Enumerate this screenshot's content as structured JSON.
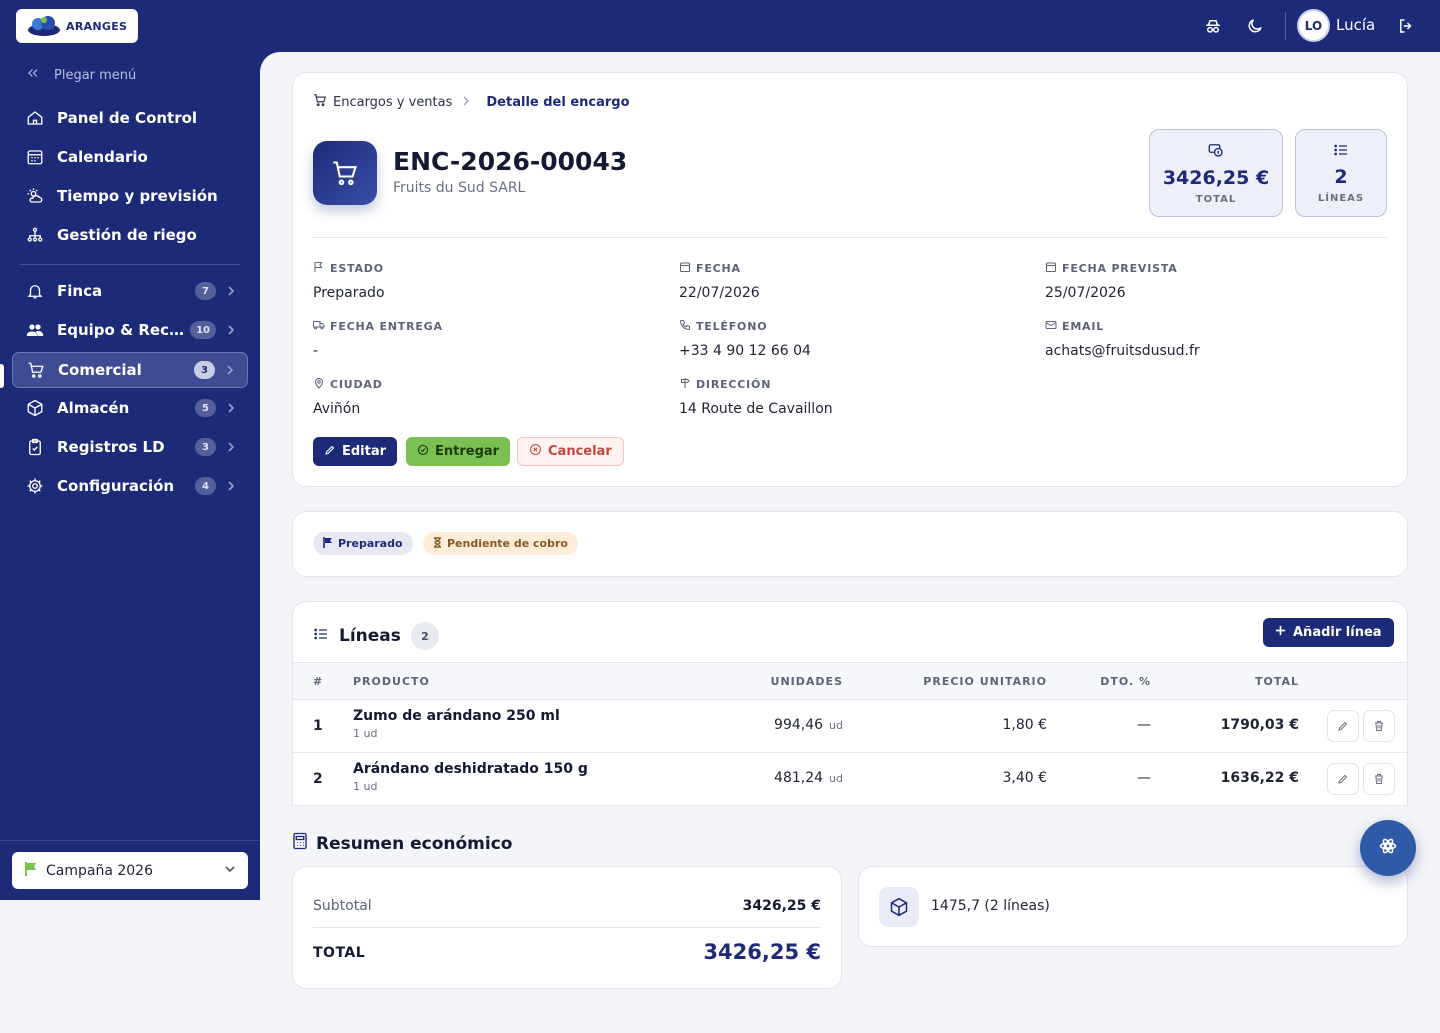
{
  "app": {
    "logo_text": "ARANGES"
  },
  "user": {
    "initials": "LO",
    "name": "Lucía"
  },
  "sidebar": {
    "collapse_label": "Plegar menú",
    "items": [
      {
        "label": "Panel de Control",
        "icon": "home-icon"
      },
      {
        "label": "Calendario",
        "icon": "calendar-icon"
      },
      {
        "label": "Tiempo y previsión",
        "icon": "weather-icon"
      },
      {
        "label": "Gestión de riego",
        "icon": "irrigation-icon"
      },
      {
        "label": "Finca",
        "icon": "sprout-icon",
        "badge": "7"
      },
      {
        "label": "Equipo & Recursos",
        "icon": "team-icon",
        "badge": "10"
      },
      {
        "label": "Comercial",
        "icon": "cart-icon",
        "badge": "3",
        "active": true
      },
      {
        "label": "Almacén",
        "icon": "box-icon",
        "badge": "5"
      },
      {
        "label": "Registros LD",
        "icon": "clipboard-icon",
        "badge": "3"
      },
      {
        "label": "Configuración",
        "icon": "gear-icon",
        "badge": "4"
      }
    ],
    "campaign": "Campaña 2026"
  },
  "breadcrumb": {
    "parent": "Encargos y ventas",
    "current": "Detalle del encargo"
  },
  "order": {
    "code": "ENC-2026-00043",
    "client": "Fruits du Sud SARL",
    "stats": {
      "total_value": "3426,25 €",
      "total_label": "TOTAL",
      "lines_value": "2",
      "lines_label": "LÍNEAS"
    },
    "fields": {
      "estado": {
        "label": "ESTADO",
        "value": "Preparado"
      },
      "fecha": {
        "label": "FECHA",
        "value": "22/07/2026"
      },
      "fecha_prevista": {
        "label": "FECHA PREVISTA",
        "value": "25/07/2026"
      },
      "fecha_entrega": {
        "label": "FECHA ENTREGA",
        "value": "-"
      },
      "telefono": {
        "label": "TELÉFONO",
        "value": "+33 4 90 12 66 04"
      },
      "email": {
        "label": "EMAIL",
        "value": "achats@fruitsdusud.fr"
      },
      "ciudad": {
        "label": "CIUDAD",
        "value": "Aviñón"
      },
      "direccion": {
        "label": "DIRECCIÓN",
        "value": "14 Route de Cavaillon"
      }
    },
    "actions": {
      "edit": "Editar",
      "deliver": "Entregar",
      "cancel": "Cancelar"
    },
    "status_pills": {
      "prepared": "Preparado",
      "pending": "Pendiente de cobro"
    }
  },
  "lines": {
    "title": "Líneas",
    "count": "2",
    "add_label": "Añadir línea",
    "columns": {
      "num": "#",
      "product": "PRODUCTO",
      "units": "UNIDADES",
      "unit_price": "PRECIO UNITARIO",
      "discount": "DTO. %",
      "total": "TOTAL"
    },
    "rows": [
      {
        "num": "1",
        "product": "Zumo de arándano 250 ml",
        "unit_desc": "1 ud",
        "units": "994,46",
        "unit_suffix": "ud",
        "unit_price": "1,80 €",
        "discount": "—",
        "total": "1790,03 €"
      },
      {
        "num": "2",
        "product": "Arándano deshidratado 150 g",
        "unit_desc": "1 ud",
        "units": "481,24",
        "unit_suffix": "ud",
        "unit_price": "3,40 €",
        "discount": "—",
        "total": "1636,22 €"
      }
    ]
  },
  "summary": {
    "title": "Resumen económico",
    "subtotal_label": "Subtotal",
    "subtotal_value": "3426,25 €",
    "total_label": "TOTAL",
    "total_value": "3426,25 €",
    "units_text": "1475,7 (2 líneas)"
  },
  "colors": {
    "primary": "#1d2a78",
    "success": "#7ac053",
    "danger": "#c0493a",
    "pending_bg": "#fcecd8"
  }
}
